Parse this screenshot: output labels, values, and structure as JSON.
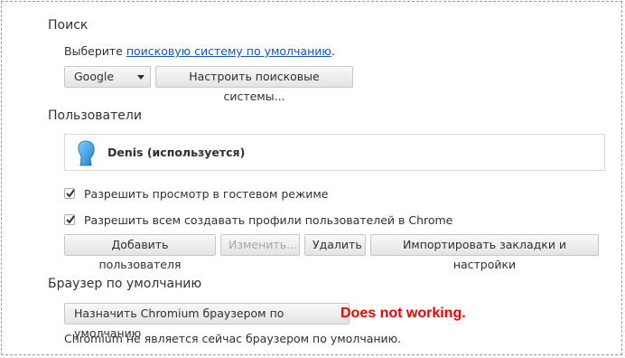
{
  "search": {
    "title": "Поиск",
    "desc_prefix": "Выберите ",
    "desc_link": "поисковую систему по умолчанию",
    "desc_suffix": ".",
    "engine_value": "Google",
    "manage_button": "Настроить поисковые системы..."
  },
  "users": {
    "title": "Пользователи",
    "user_name": "Denis (используется)",
    "guest_checkbox": {
      "label": "Разрешить просмотр в гостевом режиме",
      "checked": true
    },
    "profiles_checkbox": {
      "label": "Разрешить всем создавать профили пользователей в Chrome",
      "checked": true
    },
    "buttons": {
      "add": "Добавить пользователя",
      "edit": "Изменить...",
      "delete": "Удалить",
      "import": "Импортировать закладки и настройки"
    }
  },
  "default_browser": {
    "title": "Браузер по умолчанию",
    "make_default_button": "Назначить Chromium браузером по умолчанию",
    "annotation": "Does not working.",
    "status": "Chromium не является сейчас браузером по умолчанию."
  },
  "colors": {
    "link": "#1155cc",
    "annotation": "#ee0000"
  }
}
